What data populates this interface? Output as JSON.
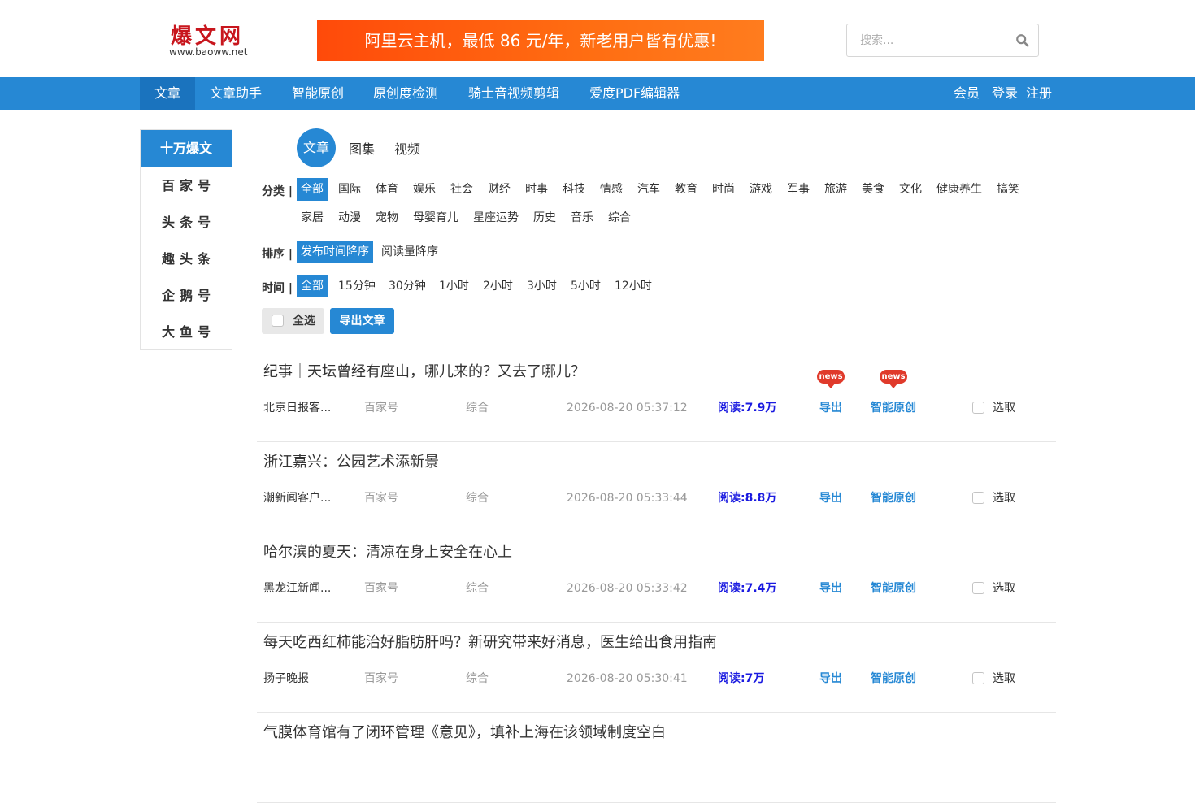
{
  "logo": {
    "main": "爆文网",
    "sub": "www.baoww.net"
  },
  "banner": {
    "text": "阿里云主机，最低 86 元/年，新老用户皆有优惠!"
  },
  "search": {
    "placeholder": "搜索..."
  },
  "nav": {
    "items": [
      {
        "label": "文章",
        "active": true
      },
      {
        "label": "文章助手"
      },
      {
        "label": "智能原创"
      },
      {
        "label": "原创度检测"
      },
      {
        "label": "骑士音视频剪辑"
      },
      {
        "label": "爱度PDF编辑器"
      }
    ],
    "right": [
      "会员",
      "登录",
      "注册"
    ]
  },
  "sidebar": {
    "items": [
      "十万爆文",
      "百家号",
      "头条号",
      "趣头条",
      "企鹅号",
      "大鱼号"
    ]
  },
  "type_tabs": [
    "文章",
    "图集",
    "视频"
  ],
  "filters": {
    "category_label": "分类 |",
    "categories_row1": [
      "全部",
      "国际",
      "体育",
      "娱乐",
      "社会",
      "财经",
      "时事",
      "科技",
      "情感",
      "汽车",
      "教育",
      "时尚",
      "游戏",
      "军事",
      "旅游",
      "美食",
      "文化",
      "健康养生",
      "搞笑"
    ],
    "categories_row2": [
      "家居",
      "动漫",
      "宠物",
      "母婴育儿",
      "星座运势",
      "历史",
      "音乐",
      "综合"
    ],
    "sort_label": "排序 |",
    "sorts": [
      "发布时间降序",
      "阅读量降序"
    ],
    "time_label": "时间 |",
    "times": [
      "全部",
      "15分钟",
      "30分钟",
      "1小时",
      "2小时",
      "3小时",
      "5小时",
      "12小时"
    ]
  },
  "actions": {
    "select_all": "全选",
    "export": "导出文章"
  },
  "badge_text": "news",
  "articles": [
    {
      "title": "纪事｜天坛曾经有座山，哪儿来的？又去了哪儿？",
      "author": "北京日报客...",
      "platform": "百家号",
      "category": "综合",
      "time": "2026-08-20 05:37:12",
      "reads": "阅读:7.9万",
      "export": "导出",
      "ai": "智能原创",
      "pick": "选取"
    },
    {
      "title": "浙江嘉兴：公园艺术添新景",
      "author": "潮新闻客户...",
      "platform": "百家号",
      "category": "综合",
      "time": "2026-08-20 05:33:44",
      "reads": "阅读:8.8万",
      "export": "导出",
      "ai": "智能原创",
      "pick": "选取"
    },
    {
      "title": "哈尔滨的夏天：清凉在身上安全在心上",
      "author": "黑龙江新闻...",
      "platform": "百家号",
      "category": "综合",
      "time": "2026-08-20 05:33:42",
      "reads": "阅读:7.4万",
      "export": "导出",
      "ai": "智能原创",
      "pick": "选取"
    },
    {
      "title": "每天吃西红柿能治好脂肪肝吗？新研究带来好消息，医生给出食用指南",
      "author": "扬子晚报",
      "platform": "百家号",
      "category": "综合",
      "time": "2026-08-20 05:30:41",
      "reads": "阅读:7万",
      "export": "导出",
      "ai": "智能原创",
      "pick": "选取"
    },
    {
      "title": "气膜体育馆有了闭环管理《意见》，填补上海在该领域制度空白"
    }
  ]
}
